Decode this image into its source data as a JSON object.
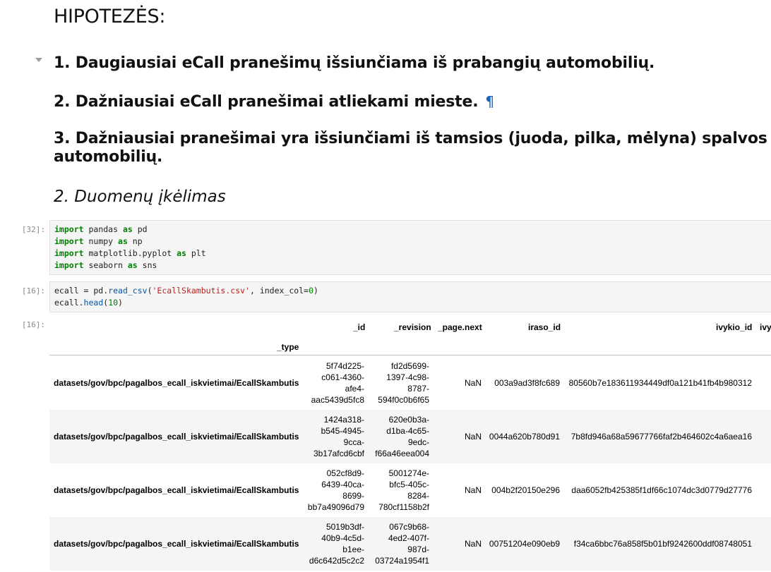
{
  "title": "HIPOTEZĖS:",
  "hypotheses": [
    "1. Daugiausiai eCall pranešimų išsiunčiama iš prabangių automobilių.",
    "2. Dažniausiai eCall pranešimai atliekami mieste.",
    "3. Dažniausiai pranešimai yra išsiunčiami iš tamsios (juoda, pilka, mėlyna) spalvos",
    "automobilių."
  ],
  "anchor_symbol": "¶",
  "section_heading": "2. Duomenų įkėlimas",
  "cells": [
    {
      "prompt": "[32]:",
      "lines": [
        [
          [
            "kw",
            "import"
          ],
          [
            "t",
            " pandas "
          ],
          [
            "kw",
            "as"
          ],
          [
            "t",
            " pd"
          ]
        ],
        [
          [
            "kw",
            "import"
          ],
          [
            "t",
            " numpy "
          ],
          [
            "kw",
            "as"
          ],
          [
            "t",
            " np"
          ]
        ],
        [
          [
            "kw",
            "import"
          ],
          [
            "t",
            " matplotlib.pyplot "
          ],
          [
            "kw",
            "as"
          ],
          [
            "t",
            " plt"
          ]
        ],
        [
          [
            "kw",
            "import"
          ],
          [
            "t",
            " seaborn "
          ],
          [
            "kw",
            "as"
          ],
          [
            "t",
            " sns"
          ]
        ]
      ]
    },
    {
      "prompt": "[16]:",
      "lines": [
        [
          [
            "t",
            "ecall = pd."
          ],
          [
            "fn",
            "read_csv"
          ],
          [
            "t",
            "("
          ],
          [
            "str",
            "'EcallSkambutis.csv'"
          ],
          [
            "t",
            ", index_col="
          ],
          [
            "num",
            "0"
          ],
          [
            "t",
            ")"
          ]
        ],
        [
          [
            "t",
            "ecall."
          ],
          [
            "fn",
            "head"
          ],
          [
            "t",
            "("
          ],
          [
            "num",
            "10"
          ],
          [
            "t",
            ")"
          ]
        ]
      ]
    }
  ],
  "output_prompt": "[16]:",
  "table": {
    "columns": [
      "_id",
      "_revision",
      "_page.next",
      "iraso_id",
      "ivykio_id",
      "ivy"
    ],
    "index_name": "_type",
    "rows": [
      {
        "type": "datasets/gov/bpc/pagalbos_ecall_iskvietimai/EcallSkambutis",
        "_id": [
          "5f74d225-",
          "c061-4360-",
          "afe4-",
          "aac5439d5fc8"
        ],
        "_revision": [
          "fd2d5699-",
          "1397-4c98-",
          "8787-",
          "594f0c0b6f65"
        ],
        "_page_next": "NaN",
        "iraso_id": "003a9ad3f8fc689",
        "ivykio_id": "80560b7e183611934449df0a121b41fb4b980312"
      },
      {
        "type": "datasets/gov/bpc/pagalbos_ecall_iskvietimai/EcallSkambutis",
        "_id": [
          "1424a318-",
          "b545-4945-",
          "9cca-",
          "3b17afcd6cbf"
        ],
        "_revision": [
          "620e0b3a-",
          "d1ba-4c65-",
          "9edc-",
          "f66a46eea004"
        ],
        "_page_next": "NaN",
        "iraso_id": "0044a620b780d91",
        "ivykio_id": "7b8fd946a68a59677766faf2b464602c4a6aea16"
      },
      {
        "type": "datasets/gov/bpc/pagalbos_ecall_iskvietimai/EcallSkambutis",
        "_id": [
          "052cf8d9-",
          "6439-40ca-",
          "8699-",
          "bb7a49096d79"
        ],
        "_revision": [
          "5001274e-",
          "bfc5-405c-",
          "8284-",
          "780cf1158b2f"
        ],
        "_page_next": "NaN",
        "iraso_id": "004b2f20150e296",
        "ivykio_id": "daa6052fb425385f1df66c1074dc3d0779d27776"
      },
      {
        "type": "datasets/gov/bpc/pagalbos_ecall_iskvietimai/EcallSkambutis",
        "_id": [
          "5019b3df-",
          "40b9-4c5d-",
          "b1ee-",
          "d6c642d5c2c2"
        ],
        "_revision": [
          "067c9b68-",
          "4ed2-407f-",
          "987d-",
          "03724a1954f1"
        ],
        "_page_next": "NaN",
        "iraso_id": "00751204e090eb9",
        "ivykio_id": "f34ca6bbc76a858f5b01bf9242600ddf08748051"
      }
    ]
  }
}
